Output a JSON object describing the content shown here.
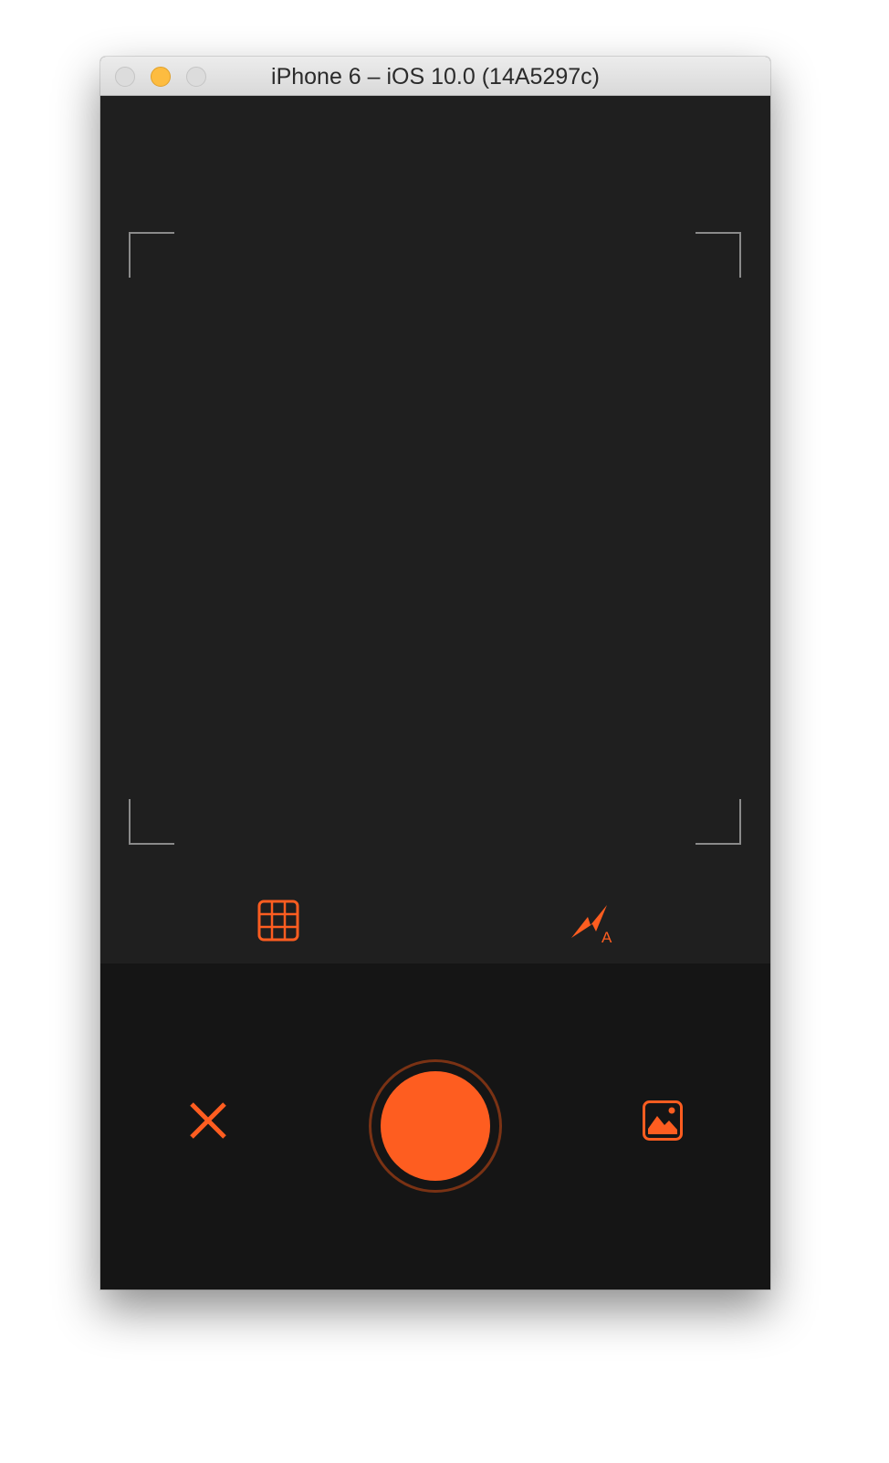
{
  "window": {
    "title": "iPhone 6 – iOS 10.0 (14A5297c)"
  },
  "colors": {
    "accent": "#fe5d20",
    "viewfinder_background": "#1f1f1f",
    "bottom_bar_background": "#151515",
    "frame_guides": "#8a8a8a"
  },
  "icons": {
    "grid": "grid-icon",
    "flash": "flash-auto-icon",
    "flash_mode_letter": "A",
    "cancel": "close-icon",
    "shutter": "shutter-button",
    "gallery": "photo-library-icon"
  }
}
